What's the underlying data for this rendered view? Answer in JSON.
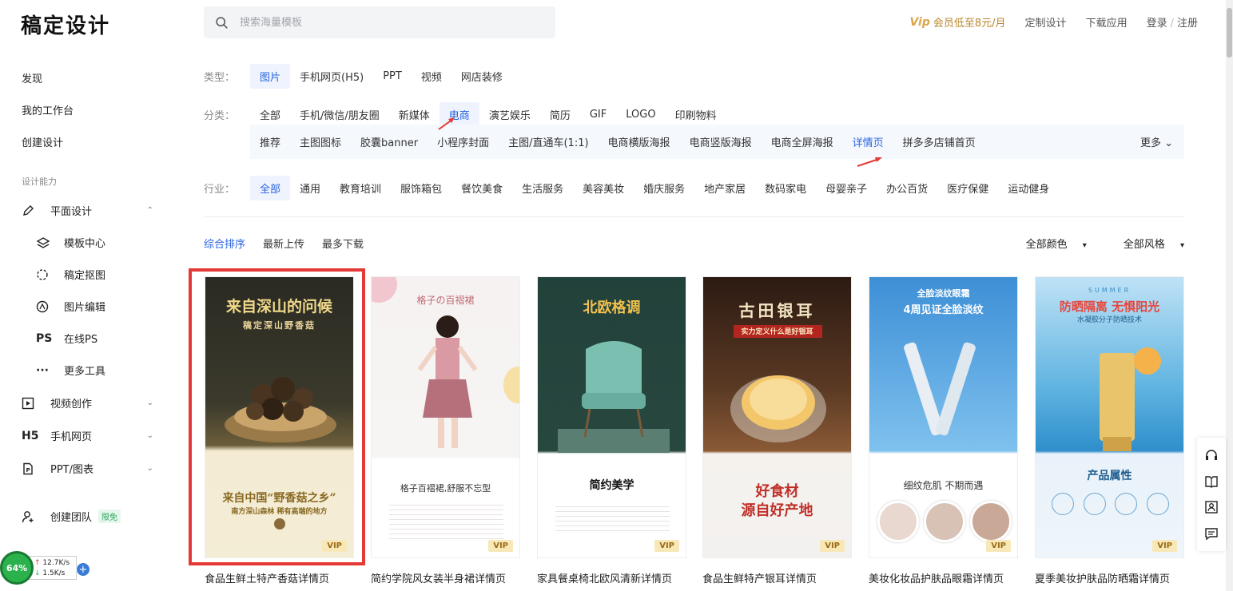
{
  "header": {
    "logo": "稿定设计",
    "search_placeholder": "搜索海量模板",
    "vip_icon_text": "Vip",
    "vip_promo": "会员低至8元/月",
    "custom_design": "定制设计",
    "download_app": "下载应用",
    "login": "登录",
    "register": "注册"
  },
  "sidebar": {
    "discover": "发现",
    "workspace": "我的工作台",
    "create": "创建设计",
    "section_label": "设计能力",
    "graphic_design": "平面设计",
    "sub": [
      "模板中心",
      "稿定抠图",
      "图片编辑",
      "在线PS",
      "更多工具"
    ],
    "ps_icon": "PS",
    "video": "视频创作",
    "h5_icon": "H5",
    "h5": "手机网页",
    "ppt": "PPT/图表",
    "team": "创建团队",
    "team_tag": "限免"
  },
  "filters": {
    "type_label": "类型：",
    "types": [
      "图片",
      "手机网页(H5)",
      "PPT",
      "视频",
      "网店装修"
    ],
    "category_label": "分类：",
    "categories": [
      "全部",
      "手机/微信/朋友圈",
      "新媒体",
      "电商",
      "演艺娱乐",
      "简历",
      "GIF",
      "LOGO",
      "印刷物料"
    ],
    "subcategories": [
      "推荐",
      "主图图标",
      "胶囊banner",
      "小程序封面",
      "主图/直通车(1:1)",
      "电商横版海报",
      "电商竖版海报",
      "电商全屏海报",
      "详情页",
      "拼多多店铺首页"
    ],
    "more": "更多",
    "industry_label": "行业：",
    "industries": [
      "全部",
      "通用",
      "教育培训",
      "服饰箱包",
      "餐饮美食",
      "生活服务",
      "美容美妆",
      "婚庆服务",
      "地产家居",
      "数码家电",
      "母婴亲子",
      "办公百货",
      "医疗保健",
      "运动健身"
    ]
  },
  "sort": {
    "options": [
      "综合排序",
      "最新上传",
      "最多下载"
    ],
    "color": "全部颜色",
    "style": "全部风格"
  },
  "cards": [
    {
      "title": "食品生鲜土特产香菇详情页",
      "headline": "来自深山的问候",
      "sub": "稿定深山野香菇",
      "bottom1": "来自中国“野香菇之乡”",
      "bottom2": "南方深山森林 稀有高端的地方",
      "badge": "VIP"
    },
    {
      "title": "简约学院风女装半身裙详情页",
      "headline": "格子の百褶裙",
      "sub": "格子百褶裙,舒服不忘型",
      "badge": "VIP"
    },
    {
      "title": "家具餐桌椅北欧风清新详情页",
      "headline": "北欧格调",
      "sub": "简约美学",
      "badge": "VIP"
    },
    {
      "title": "食品生鲜特产银耳详情页",
      "headline": "古田银耳",
      "sub": "实力定义什么是好银耳",
      "bottom1": "好食材",
      "bottom2": "源自好产地",
      "badge": "VIP"
    },
    {
      "title": "美妆化妆品护肤品眼霜详情页",
      "headline": "全脸淡纹眼霜",
      "sub": "4周见证全脸淡纹",
      "bottom1": "细纹危肌 不期而遇",
      "badge": "VIP"
    },
    {
      "title": "夏季美妆护肤品防晒霜详情页",
      "headline": "防晒隔离 无惧阳光",
      "sub": "水凝胶分子防晒技术",
      "bottom1": "产品属性",
      "topline": "SUMMER",
      "badge": "VIP"
    }
  ],
  "speed": {
    "percent": "64%",
    "up": "12.7K/s",
    "down": "1.5K/s"
  },
  "colors": {
    "accent": "#2a64e0",
    "highlight": "#e53935"
  }
}
